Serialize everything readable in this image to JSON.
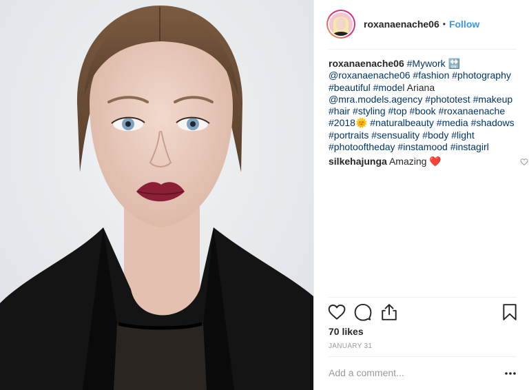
{
  "post": {
    "photo_icon": "portrait-photo",
    "user": {
      "username": "roxanaenache06",
      "follow_label": "Follow",
      "separator": "•"
    },
    "caption": {
      "username": "roxanaenache06",
      "segments": [
        {
          "t": "tag",
          "v": "#Mywork"
        },
        {
          "t": "text",
          "v": " 🔛 "
        },
        {
          "t": "tag",
          "v": "@roxanaenache06"
        },
        {
          "t": "text",
          "v": " "
        },
        {
          "t": "tag",
          "v": "#fashion"
        },
        {
          "t": "text",
          "v": " "
        },
        {
          "t": "tag",
          "v": "#photography"
        },
        {
          "t": "text",
          "v": " "
        },
        {
          "t": "tag",
          "v": "#beautiful"
        },
        {
          "t": "text",
          "v": " "
        },
        {
          "t": "tag",
          "v": "#model"
        },
        {
          "t": "text",
          "v": " Ariana "
        },
        {
          "t": "tag",
          "v": "@mra.models.agency"
        },
        {
          "t": "text",
          "v": " "
        },
        {
          "t": "tag",
          "v": "#phototest"
        },
        {
          "t": "text",
          "v": " "
        },
        {
          "t": "tag",
          "v": "#makeup"
        },
        {
          "t": "text",
          "v": " "
        },
        {
          "t": "tag",
          "v": "#hair"
        },
        {
          "t": "text",
          "v": " "
        },
        {
          "t": "tag",
          "v": "#styling"
        },
        {
          "t": "text",
          "v": " "
        },
        {
          "t": "tag",
          "v": "#top"
        },
        {
          "t": "text",
          "v": " "
        },
        {
          "t": "tag",
          "v": "#book"
        },
        {
          "t": "text",
          "v": " "
        },
        {
          "t": "tag",
          "v": "#roxanaenache"
        },
        {
          "t": "text",
          "v": " "
        },
        {
          "t": "tag",
          "v": "#2018"
        },
        {
          "t": "text",
          "v": "🌞 "
        },
        {
          "t": "tag",
          "v": "#naturalbeauty"
        },
        {
          "t": "text",
          "v": " "
        },
        {
          "t": "tag",
          "v": "#media"
        },
        {
          "t": "text",
          "v": " "
        },
        {
          "t": "tag",
          "v": "#shadows"
        },
        {
          "t": "text",
          "v": " "
        },
        {
          "t": "tag",
          "v": "#portraits"
        },
        {
          "t": "text",
          "v": " "
        },
        {
          "t": "tag",
          "v": "#sensuality"
        },
        {
          "t": "text",
          "v": " "
        },
        {
          "t": "tag",
          "v": "#body"
        },
        {
          "t": "text",
          "v": " "
        },
        {
          "t": "tag",
          "v": "#light"
        },
        {
          "t": "text",
          "v": " "
        },
        {
          "t": "tag",
          "v": "#photooftheday"
        },
        {
          "t": "text",
          "v": " "
        },
        {
          "t": "tag",
          "v": "#instamood"
        },
        {
          "t": "text",
          "v": " "
        },
        {
          "t": "tag",
          "v": "#instagirl"
        }
      ]
    },
    "comments": [
      {
        "username": "silkehajunga",
        "text": "Amazing",
        "emoji": "❤️"
      }
    ],
    "likes": "70 likes",
    "date": "JANUARY 31",
    "add_comment_placeholder": "Add a comment...",
    "colors": {
      "link": "#003569",
      "follow": "#3897f0",
      "heart": "#ed4956",
      "muted": "#999999"
    },
    "icons": {
      "like": "heart-icon",
      "comment": "comment-bubble-icon",
      "share": "share-icon",
      "save": "bookmark-icon",
      "more": "more-options-icon"
    }
  }
}
